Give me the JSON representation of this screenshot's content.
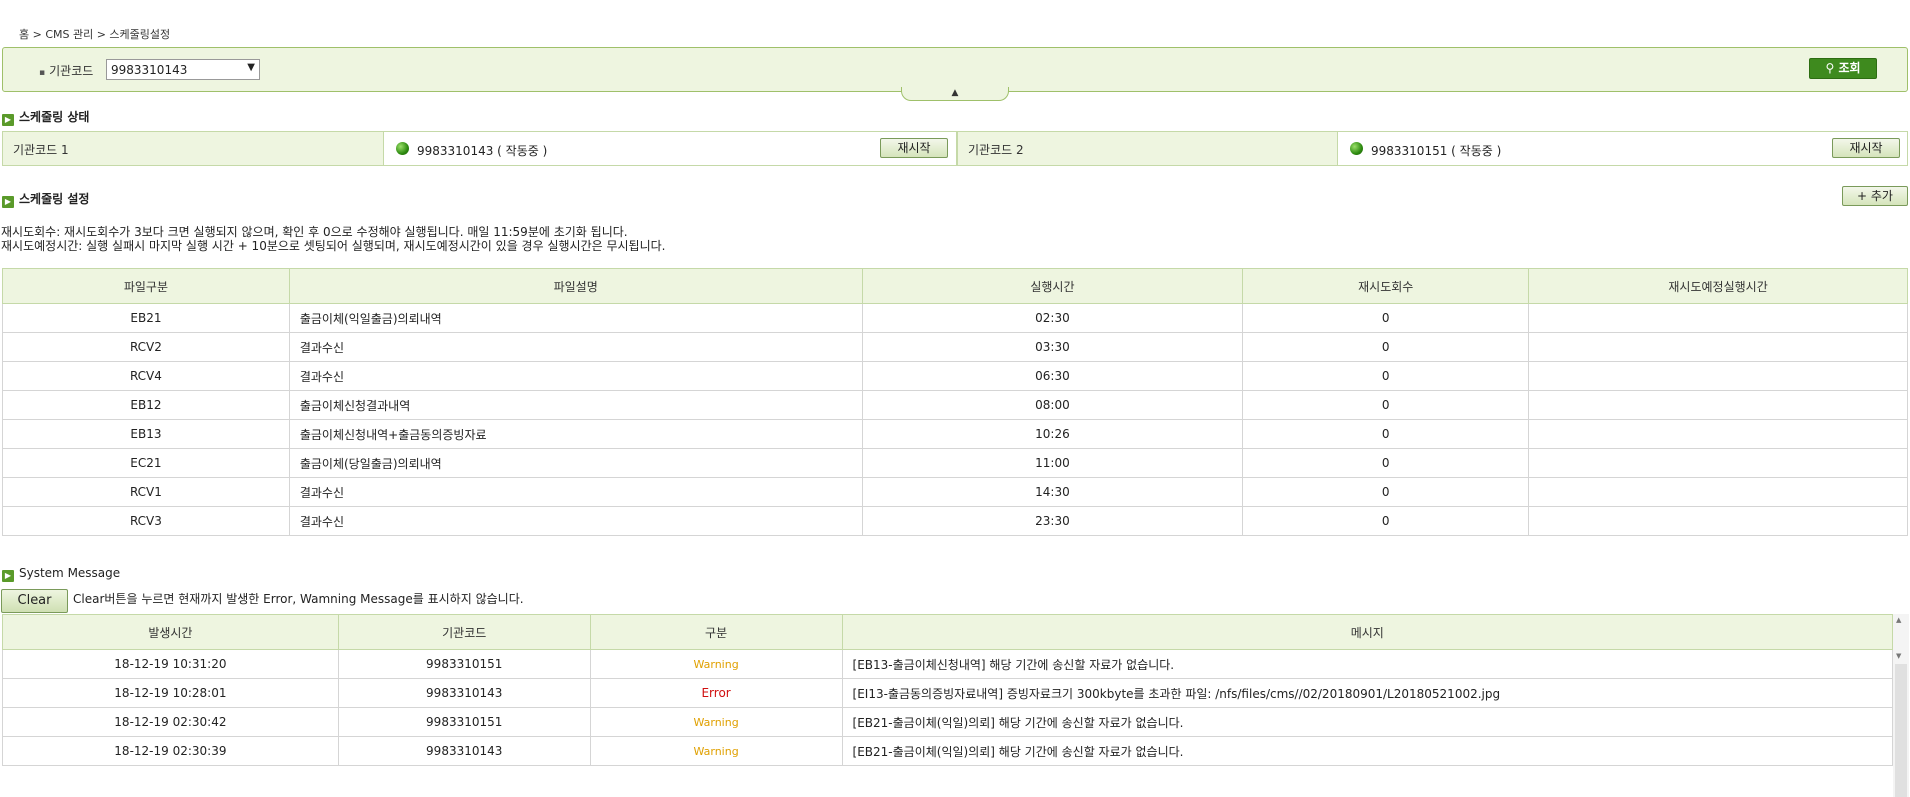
{
  "breadcrumb": "홈 > CMS 관리 > 스케줄링설정",
  "search": {
    "label": "기관코드",
    "selected": "9983310143",
    "button": "조회"
  },
  "status_section": {
    "title": "스케줄링 상태",
    "items": [
      {
        "label": "기관코드 1",
        "value": "9983310143 ( 작동중 )",
        "button": "재시작"
      },
      {
        "label": "기관코드 2",
        "value": "9983310151 ( 작동중 )",
        "button": "재시작"
      }
    ]
  },
  "schedule_section": {
    "title": "스케줄링 설정",
    "add_button": "+ 추가",
    "notes": [
      "재시도회수: 재시도회수가 3보다 크면 실행되지 않으며, 확인 후 0으로 수정해야 실행됩니다. 매일 11:59분에 초기화 됩니다.",
      "재시도예정시간: 실행 실패시 마지막 실행 시간 + 10분으로 셋팅되어 실행되며, 재시도예정시간이 있을 경우 실행시간은 무시됩니다."
    ],
    "columns": [
      "파일구분",
      "파일설명",
      "실행시간",
      "재시도회수",
      "재시도예정실행시간"
    ],
    "rows": [
      [
        "EB21",
        "출금이체(익일출금)의뢰내역",
        "02:30",
        "0",
        ""
      ],
      [
        "RCV2",
        "결과수신",
        "03:30",
        "0",
        ""
      ],
      [
        "RCV4",
        "결과수신",
        "06:30",
        "0",
        ""
      ],
      [
        "EB12",
        "출금이체신청결과내역",
        "08:00",
        "0",
        ""
      ],
      [
        "EB13",
        "출금이체신청내역+출금동의증빙자료",
        "10:26",
        "0",
        ""
      ],
      [
        "EC21",
        "출금이체(당일출금)의뢰내역",
        "11:00",
        "0",
        ""
      ],
      [
        "RCV1",
        "결과수신",
        "14:30",
        "0",
        ""
      ],
      [
        "RCV3",
        "결과수신",
        "23:30",
        "0",
        ""
      ]
    ]
  },
  "system_section": {
    "title": "System Message",
    "clear_button": "Clear",
    "note": "Clear버튼을 누르면 현재까지 발생한 Error, Wamning Message를 표시하지 않습니다.",
    "columns": [
      "발생시간",
      "기관코드",
      "구분",
      "메시지"
    ],
    "rows": [
      [
        "18-12-19 10:31:20",
        "9983310151",
        "Warning",
        "[EB13-출금이체신청내역] 해당 기간에 송신할 자료가 없습니다."
      ],
      [
        "18-12-19 10:28:01",
        "9983310143",
        "Error",
        "[EI13-출금동의증빙자료내역] 증빙자료크기 300kbyte를 초과한 파일: /nfs/files/cms//02/20180901/L20180521002.jpg"
      ],
      [
        "18-12-19 02:30:42",
        "9983310151",
        "Warning",
        "[EB21-출금이체(익일)의뢰] 해당 기간에 송신할 자료가 없습니다."
      ],
      [
        "18-12-19 02:30:39",
        "9983310143",
        "Warning",
        "[EB21-출금이체(익일)의뢰] 해당 기간에 송신할 자료가 없습니다."
      ]
    ]
  },
  "colors": {
    "accent_green": "#3e8a1e",
    "panel_bg": "#eef5e0",
    "warning": "#e0a000",
    "error": "#d01010"
  }
}
